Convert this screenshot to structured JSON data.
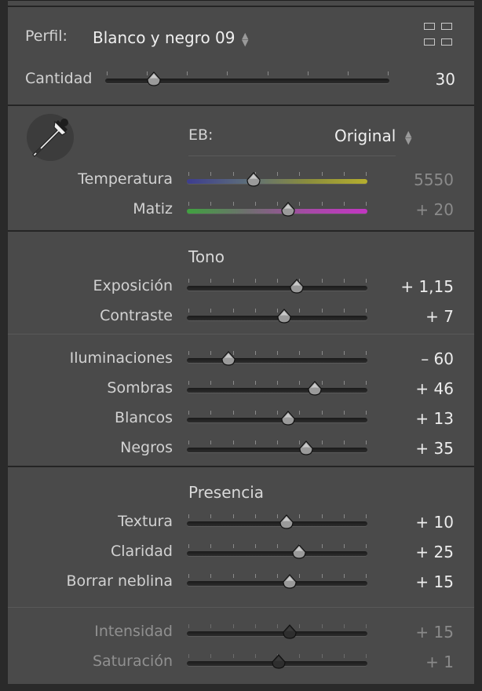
{
  "profile": {
    "label": "Perfil:",
    "value": "Blanco y negro 09",
    "amount_label": "Cantidad",
    "amount_value": "30",
    "amount_fraction": 0.17
  },
  "wb": {
    "label": "EB:",
    "value": "Original",
    "sliders": [
      {
        "label": "Temperatura",
        "value": "5550",
        "pos": 0.37,
        "dim_value": true
      },
      {
        "label": "Matiz",
        "value": "+ 20",
        "pos": 0.56,
        "dim_value": true
      }
    ]
  },
  "tone": {
    "title": "Tono",
    "group1": [
      {
        "label": "Exposición",
        "value": "+ 1,15",
        "pos": 0.61
      },
      {
        "label": "Contraste",
        "value": "+ 7",
        "pos": 0.54
      }
    ],
    "group2": [
      {
        "label": "Iluminaciones",
        "value": "– 60",
        "pos": 0.23
      },
      {
        "label": "Sombras",
        "value": "+ 46",
        "pos": 0.71
      },
      {
        "label": "Blancos",
        "value": "+ 13",
        "pos": 0.56
      },
      {
        "label": "Negros",
        "value": "+ 35",
        "pos": 0.66
      }
    ]
  },
  "presence": {
    "title": "Presencia",
    "group1": [
      {
        "label": "Textura",
        "value": "+ 10",
        "pos": 0.55
      },
      {
        "label": "Claridad",
        "value": "+ 25",
        "pos": 0.62
      },
      {
        "label": "Borrar neblina",
        "value": "+ 15",
        "pos": 0.57
      }
    ],
    "group2": [
      {
        "label": "Intensidad",
        "value": "+ 15",
        "pos": 0.57
      },
      {
        "label": "Saturación",
        "value": "+ 1",
        "pos": 0.51
      }
    ]
  },
  "icons": {
    "profile_browser": "grid-icon",
    "white_balance_selector": "eyedropper-icon",
    "stepper": "updown-arrows-icon"
  }
}
